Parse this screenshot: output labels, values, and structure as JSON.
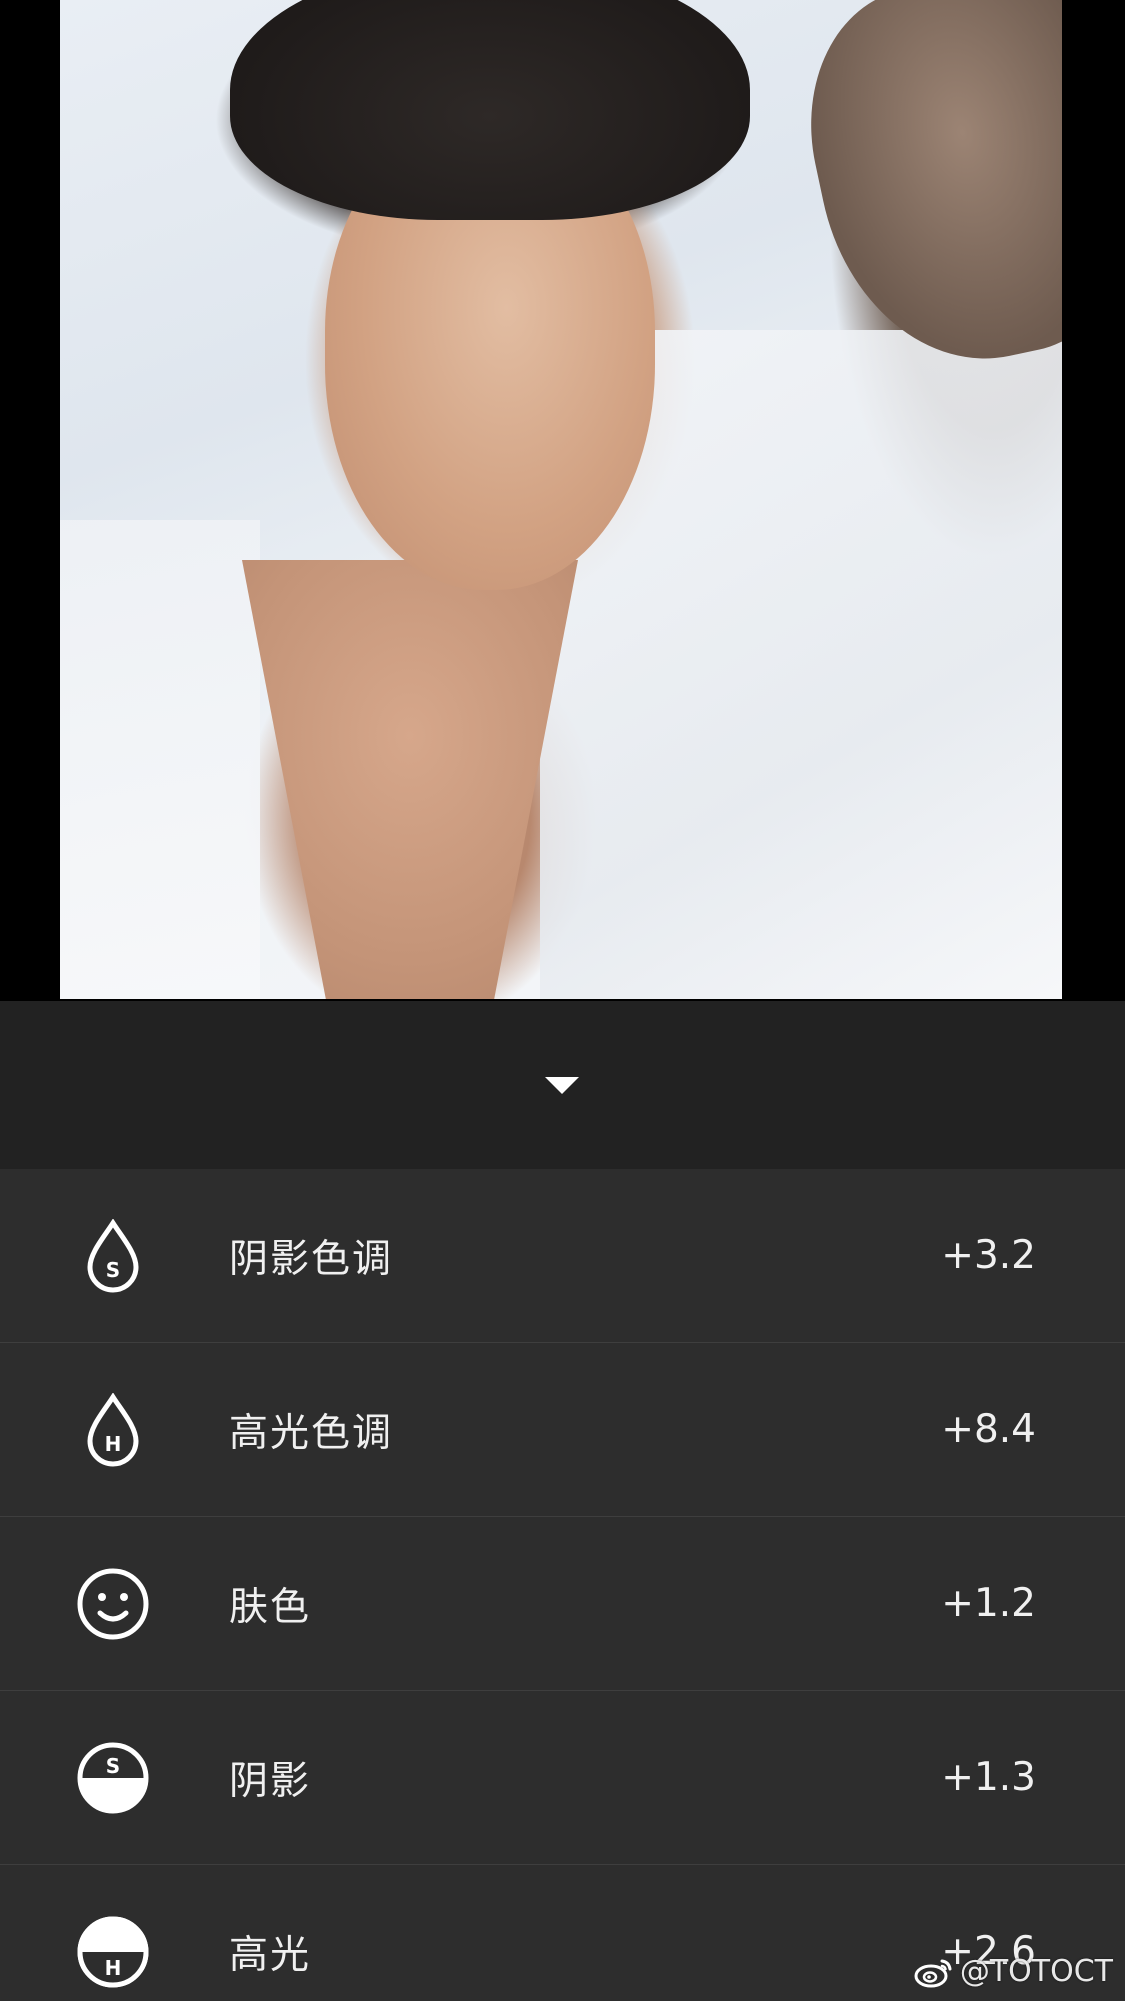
{
  "panel": {
    "collapse_icon": "chevron-down-icon"
  },
  "adjustments": [
    {
      "label": "阴影色调",
      "value": "+3.2",
      "icon": "shadow-tint-drop-icon",
      "icon_letter": "S"
    },
    {
      "label": "高光色调",
      "value": "+8.4",
      "icon": "highlight-tint-drop-icon",
      "icon_letter": "H"
    },
    {
      "label": "肤色",
      "value": "+1.2",
      "icon": "skin-tone-face-icon"
    },
    {
      "label": "阴影",
      "value": "+1.3",
      "icon": "shadows-half-circle-icon",
      "icon_letter": "S"
    },
    {
      "label": "高光",
      "value": "+2.6",
      "icon": "highlights-half-circle-icon",
      "icon_letter": "H"
    }
  ],
  "watermark": {
    "text": "@TOTOCT",
    "icon": "weibo-icon"
  },
  "colors": {
    "header_bg": "#222222",
    "list_bg": "#2d2d2d",
    "divider": "#3e3e3e",
    "text": "#f0f0f0"
  }
}
